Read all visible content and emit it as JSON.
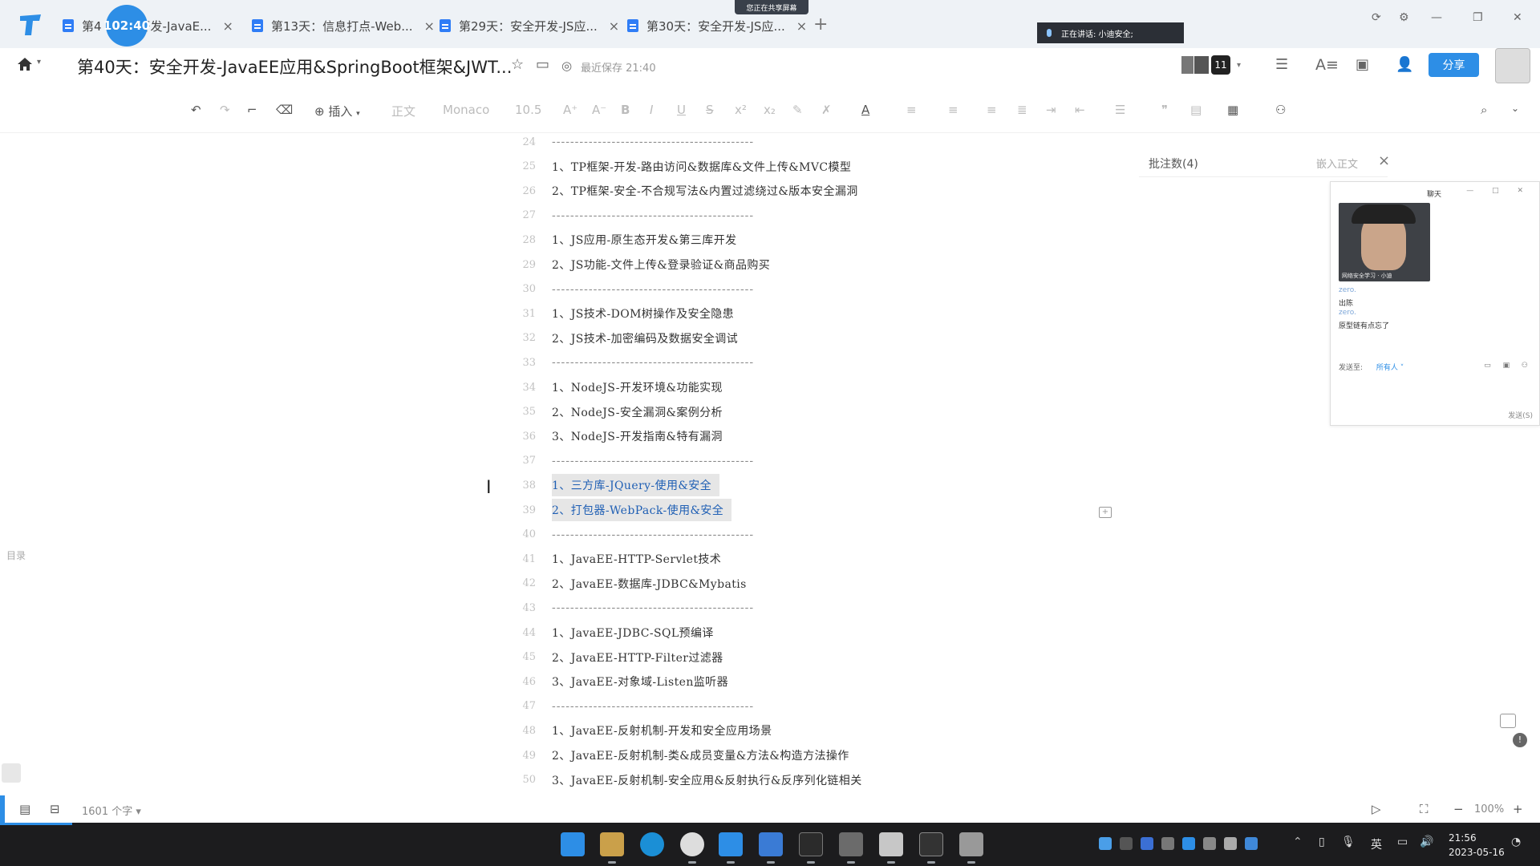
{
  "tabs": [
    {
      "label": "第4",
      "label_tail": "开发-JavaE...",
      "close": "×"
    },
    {
      "label": "第13天：信息打点-Web...",
      "close": "×"
    },
    {
      "label": "第29天：安全开发-JS应...",
      "close": "×"
    },
    {
      "label": "第30天：安全开发-JS应...",
      "close": "×"
    }
  ],
  "tab_add": "+",
  "timer": "102:40",
  "screen_share_badge": "您正在共享屏幕",
  "speaking_indicator": "正在讲话: 小迪安全;",
  "doc": {
    "title": "第40天：安全开发-JavaEE应用&SpringBoot框架&JWT...",
    "save_status": "最近保存 21:40"
  },
  "collaborators": {
    "count": "11"
  },
  "share_button": "分享",
  "toolbar": {
    "insert": "插入",
    "heading": "正文",
    "font": "Monaco",
    "font_size": "10.5"
  },
  "lines": [
    {
      "n": "24",
      "text": "--------------------------------------------",
      "type": "sep"
    },
    {
      "n": "25",
      "text": "1、TP框架-开发-路由访问&数据库&文件上传&MVC模型",
      "type": "text"
    },
    {
      "n": "26",
      "text": "2、TP框架-安全-不合规写法&内置过滤绕过&版本安全漏洞",
      "type": "text"
    },
    {
      "n": "27",
      "text": "--------------------------------------------",
      "type": "sep"
    },
    {
      "n": "28",
      "text": "1、JS应用-原生态开发&第三库开发",
      "type": "text"
    },
    {
      "n": "29",
      "text": "2、JS功能-文件上传&登录验证&商品购买",
      "type": "text"
    },
    {
      "n": "30",
      "text": "--------------------------------------------",
      "type": "sep"
    },
    {
      "n": "31",
      "text": "1、JS技术-DOM树操作及安全隐患",
      "type": "text"
    },
    {
      "n": "32",
      "text": "2、JS技术-加密编码及数据安全调试",
      "type": "text"
    },
    {
      "n": "33",
      "text": "--------------------------------------------",
      "type": "sep"
    },
    {
      "n": "34",
      "text": "1、NodeJS-开发环境&功能实现",
      "type": "text"
    },
    {
      "n": "35",
      "text": "2、NodeJS-安全漏洞&案例分析",
      "type": "text"
    },
    {
      "n": "36",
      "text": "3、NodeJS-开发指南&特有漏洞",
      "type": "text"
    },
    {
      "n": "37",
      "text": "--------------------------------------------",
      "type": "sep"
    },
    {
      "n": "38",
      "text": "1、三方库-JQuery-使用&安全",
      "type": "hl"
    },
    {
      "n": "39",
      "text": "2、打包器-WebPack-使用&安全",
      "type": "hl"
    },
    {
      "n": "40",
      "text": "--------------------------------------------",
      "type": "sep"
    },
    {
      "n": "41",
      "text": "1、JavaEE-HTTP-Servlet技术",
      "type": "text"
    },
    {
      "n": "42",
      "text": "2、JavaEE-数据库-JDBC&Mybatis",
      "type": "text"
    },
    {
      "n": "43",
      "text": "--------------------------------------------",
      "type": "sep"
    },
    {
      "n": "44",
      "text": "1、JavaEE-JDBC-SQL预编译",
      "type": "text"
    },
    {
      "n": "45",
      "text": "2、JavaEE-HTTP-Filter过滤器",
      "type": "text"
    },
    {
      "n": "46",
      "text": "3、JavaEE-对象域-Listen监听器",
      "type": "text"
    },
    {
      "n": "47",
      "text": "--------------------------------------------",
      "type": "sep"
    },
    {
      "n": "48",
      "text": "1、JavaEE-反射机制-开发和安全应用场景",
      "type": "text"
    },
    {
      "n": "49",
      "text": "2、JavaEE-反射机制-类&成员变量&方法&构造方法操作",
      "type": "text"
    },
    {
      "n": "50",
      "text": "3、JavaEE-反射机制-安全应用&反射执行&反序列化链相关",
      "type": "text"
    }
  ],
  "outline_tab": "目录",
  "comments": {
    "header": "批注数(4)",
    "embed_label": "嵌入正文",
    "close": "×"
  },
  "chat": {
    "title": "聊天",
    "video_caption": "网络安全学习 · 小迪",
    "messages": [
      {
        "sender": "zero.",
        "text": "出陈"
      },
      {
        "sender": "zero.",
        "text": "原型链有点忘了"
      }
    ],
    "send_to_label": "发送至:",
    "recipient": "所有人 ˅",
    "send_button": "发送(S)"
  },
  "status": {
    "word_count": "1601 个字 ▾",
    "zoom": "100%",
    "zoom_minus": "−",
    "zoom_plus": "+"
  },
  "taskbar": {
    "language": "英",
    "time": "21:56",
    "date": "2023-05-16"
  },
  "colors": {
    "accent": "#2d8ee6",
    "highlight_text": "#1f5fb4",
    "taskbar": "#1c1c1e"
  }
}
